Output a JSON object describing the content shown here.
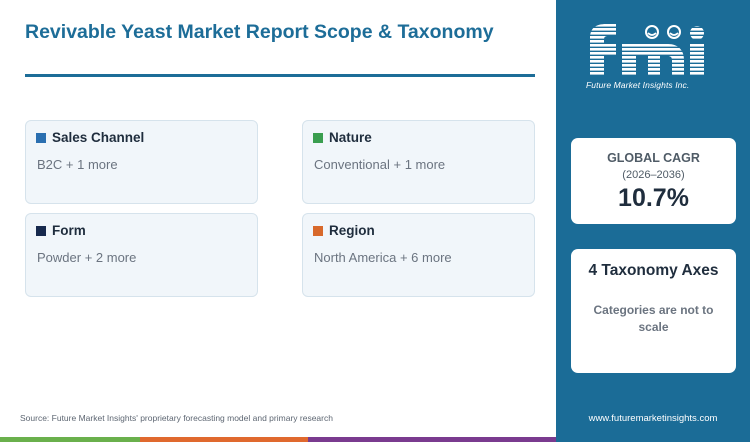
{
  "title": "Revivable Yeast Market Report Scope & Taxonomy",
  "cards": [
    {
      "name": "Sales Channel",
      "value": "B2C + 1 more",
      "color": "#2a6fb0"
    },
    {
      "name": "Nature",
      "value": "Conventional + 1 more",
      "color": "#3a9e4f"
    },
    {
      "name": "Form",
      "value": "Powder + 2 more",
      "color": "#17294d"
    },
    {
      "name": "Region",
      "value": "North America + 6 more",
      "color": "#d8692b"
    }
  ],
  "source": "Source: Future Market Insights' proprietary forecasting model and primary research",
  "logo": {
    "tagline": "Future Market Insights Inc."
  },
  "cagr": {
    "label": "GLOBAL CAGR",
    "period": "(2026–2036)",
    "value": "10.7%"
  },
  "taxonomy": {
    "title": "4 Taxonomy Axes",
    "note": "Categories are not to scale"
  },
  "website": "www.futuremarketinsights.com",
  "colors": {
    "accent": "#1d6d98",
    "side_panel": "#1b6c97",
    "bar_green": "#6ab04c",
    "bar_orange": "#e0692e",
    "bar_purple": "#7a3b8f"
  }
}
